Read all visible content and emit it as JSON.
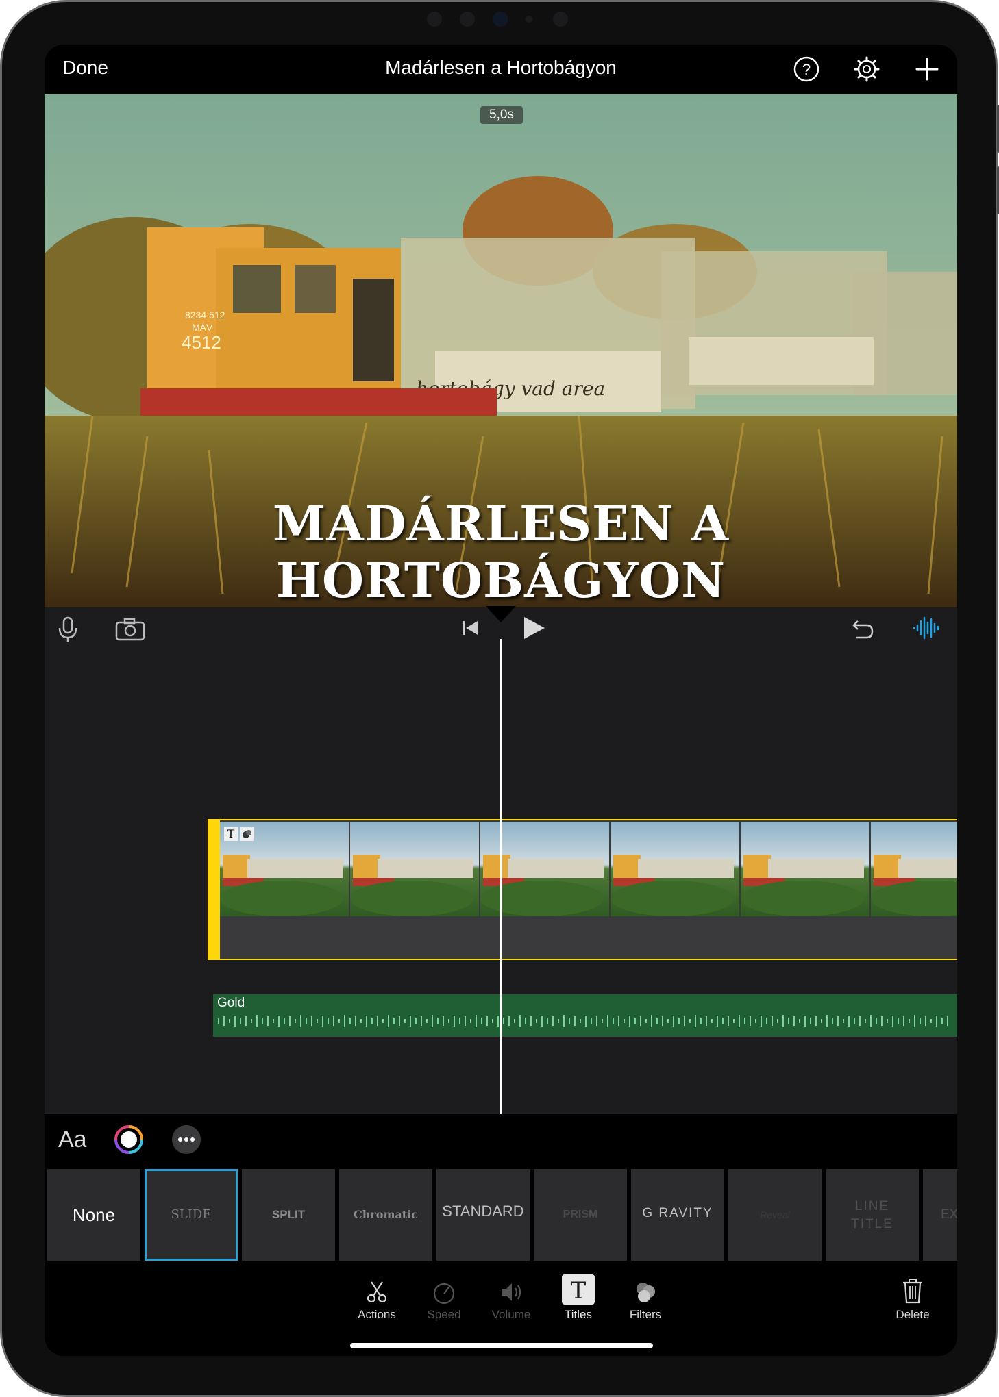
{
  "header": {
    "done_label": "Done",
    "project_title": "Madárlesen a Hortobágyon",
    "icons": [
      "help-icon",
      "settings-gear-icon",
      "add-plus-icon"
    ]
  },
  "preview": {
    "duration": "5,0s",
    "overlay_title": "MADÁRLESEN A HORTOBÁGYON",
    "locomotive_number": "4512",
    "locomotive_serial": "8234 512",
    "locomotive_mark": "MÁV",
    "wagon_caption": "hortobágy vad area"
  },
  "controls": {
    "icons": [
      "microphone-icon",
      "camera-icon",
      "skip-to-start-icon",
      "play-icon",
      "undo-icon",
      "audio-waveform-icon"
    ]
  },
  "timeline": {
    "clip_badges": [
      "T",
      "filter-badge"
    ],
    "clip_frames": 6,
    "audio_track_label": "Gold"
  },
  "title_options": {
    "font_label": "Aa",
    "icons": [
      "color-wheel-icon",
      "more-options-icon"
    ]
  },
  "title_styles": [
    {
      "label": "None",
      "selected": false
    },
    {
      "label": "SLIDE",
      "selected": true
    },
    {
      "label": "SPLIT",
      "selected": false
    },
    {
      "label": "Chromatic",
      "selected": false
    },
    {
      "label": "STANDARD",
      "selected": false
    },
    {
      "label": "PRISM",
      "selected": false
    },
    {
      "label": "G RAVITY",
      "selected": false
    },
    {
      "label": "Reveal",
      "selected": false
    },
    {
      "label": "LINE TITLE",
      "selected": false
    },
    {
      "label": "EX",
      "selected": false
    }
  ],
  "toolbar": {
    "actions_label": "Actions",
    "speed_label": "Speed",
    "volume_label": "Volume",
    "titles_label": "Titles",
    "filters_label": "Filters",
    "delete_label": "Delete",
    "active_tool": "Titles"
  },
  "colors": {
    "clip_selection": "#ffd60a",
    "audio_track": "#1f5f33",
    "selected_style_border": "#2b9fd8",
    "waveform_accent": "#1fa3e6"
  }
}
